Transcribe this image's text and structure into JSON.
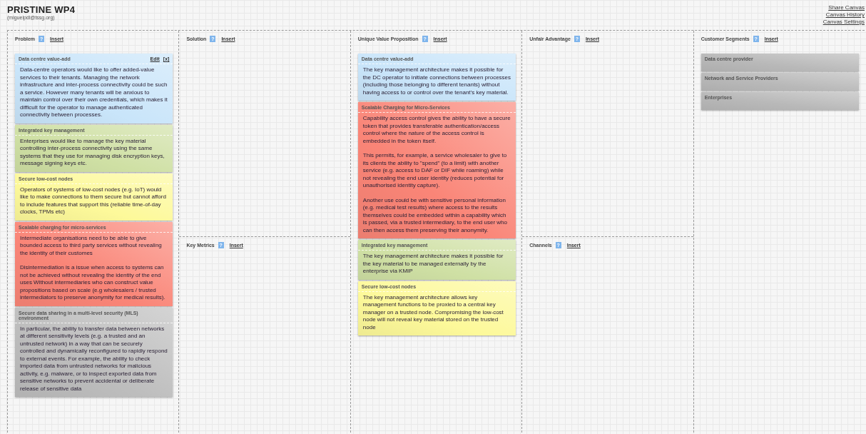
{
  "canvas": {
    "title": "PRISTINE WP4",
    "owner": "(miguelpdl@tssg.org)",
    "links": [
      "Share Canvas",
      "Canvas History",
      "Canvas Settings"
    ]
  },
  "columns": [
    {
      "sections": [
        {
          "title": "Problem",
          "help": "?",
          "insert": "Insert",
          "notes": [
            {
              "kind": "note",
              "title": "Data centre value-add",
              "color": "#c9e5fa",
              "actions": [
                "Edit",
                "[x]"
              ],
              "paragraphs": [
                "Data-centre operators would like to offer added-value services to their tenants. Managing the network infrastructure and inter-process connectivity could be such a service. However many tenants will be anxious to maintain control over their own credentials, which makes it difficult for the operator to manage authenticated connectivity between processes."
              ]
            },
            {
              "kind": "note",
              "title": "Integrated key management",
              "color": "#cfe0a4",
              "paragraphs": [
                "Enterprises would like to manage the key material controlling inter-process connectivity using the same systems that they use for managing disk encryption keys, message signing keys etc."
              ]
            },
            {
              "kind": "note",
              "title": "Secure low-cost nodes",
              "color": "#fdf99a",
              "paragraphs": [
                "Operators of systems of low-cost nodes (e.g. IoT) would like to make connections to them secure but cannot afford to include features that support this (reliable time-of-day clocks, TPMs etc)"
              ]
            },
            {
              "kind": "note",
              "title": "Scalable charging for micro-services",
              "color": "#fa8577",
              "paragraphs": [
                "Intermediate organisations need to be able to give bounded access to third party services without revealing the identity of their customes",
                "Disintermediation is a issue when access to systems can not be achieved without revealing the identity of the end uses Without intermediaries who can construct value propositions based on scale (e.g wholesalers / trusted intermediators to preserve anonymity for medical results)."
              ]
            },
            {
              "kind": "note",
              "title": "Secure data sharing in a multi-level security (MLS) environment",
              "color": "#bdbdbd",
              "paragraphs": [
                "In particular, the ability to transfer data between networks at different sensitivity levels (e.g. a trusted and an untrusted network) in a way that can be securely controlled and dynamically reconfigured to rapidly respond to external events. For example, the ability to check imported data from untrusted networks for malicious activity, e.g. malware, or to inspect exported data from sensitive networks to prevent accidental or deliberate release of sensitive data"
              ]
            }
          ]
        }
      ]
    },
    {
      "sections": [
        {
          "title": "Solution",
          "help": "?",
          "insert": "Insert"
        },
        {
          "title": "Key Metrics",
          "help": "?",
          "insert": "Insert"
        }
      ]
    },
    {
      "sections": [
        {
          "title": "Unique Value Proposition",
          "help": "?",
          "insert": "Insert",
          "notes": [
            {
              "kind": "note",
              "title": "Data centre value-add",
              "color": "#c9e5fa",
              "paragraphs": [
                "The key management architecture makes it possible for the DC operator to initiate connections between processes (including those belonging to different tenants) without having access to or control over the tenant’s key material."
              ]
            },
            {
              "kind": "note",
              "title": "Scalable Charging for Micro-Services",
              "color": "#fa8577",
              "paragraphs": [
                "Capability access control gives the ability to have a secure token that provides transferable authentication/access control where the nature of the access control is embedded in the token itself.",
                "This permits, for example, a service wholesaler to give to its clients the ability to \"spend\" (to a limit) with another service (e.g. access to DAF or DIF while roaming) while not revealing the end user identity (reduces potential for unauthorised identity capture).",
                "Another use could be with sensitive personal information (e.g. medical test results) where access to the results themselves could be embedded within a capability which is passed, via a trusted intermediary, to the end user who can then access them preserving their anonymity."
              ]
            },
            {
              "kind": "note",
              "title": "Integrated key management",
              "color": "#cfe0a4",
              "paragraphs": [
                "The key management architecture makes it possible for the key material to be managed externally by the enterprise via KMIP"
              ]
            },
            {
              "kind": "note",
              "title": "Secure low-cost nodes",
              "color": "#fdf99a",
              "paragraphs": [
                "The key management architecture allows key management functions to be proxied to a central key manager on a trusted node. Compromising the low-cost node will not reveal key material stored on the trusted node"
              ]
            }
          ]
        }
      ]
    },
    {
      "sections": [
        {
          "title": "Unfair Advantage",
          "help": "?",
          "insert": "Insert"
        },
        {
          "title": "Channels",
          "help": "?",
          "insert": "Insert"
        }
      ]
    },
    {
      "sections": [
        {
          "title": "Customer Segments",
          "help": "?",
          "insert": "Insert",
          "notes": [
            {
              "kind": "segment",
              "title": "Data centre provider",
              "color": "#b8b8b8"
            },
            {
              "kind": "segment",
              "title": "Network and Service Providers",
              "color": "#b8b8b8"
            },
            {
              "kind": "segment",
              "title": "Enterprises",
              "color": "#b8b8b8"
            }
          ]
        }
      ]
    }
  ]
}
